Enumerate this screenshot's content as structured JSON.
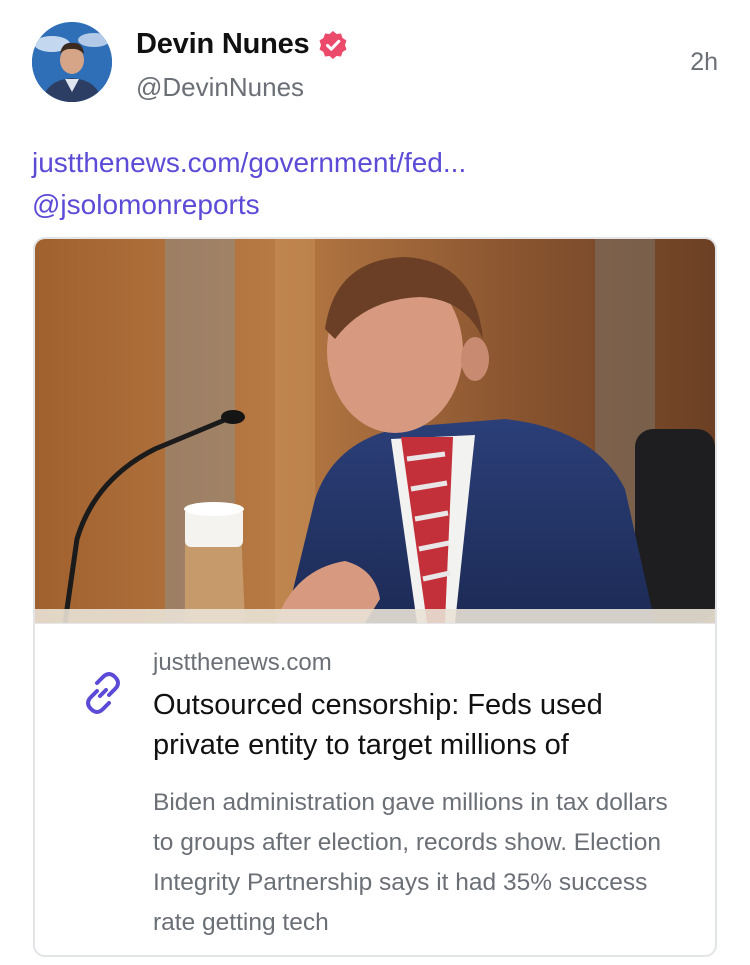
{
  "author": {
    "display_name": "Devin Nunes",
    "handle": "@DevinNunes",
    "verified": true,
    "avatar_icon": "avatar-photo"
  },
  "post": {
    "timestamp": "2h",
    "link_text": "justthenews.com/government/fed...",
    "mention_text": "@jsolomonreports"
  },
  "link_card": {
    "domain": "justthenews.com",
    "title": "Outsourced censorship: Feds used private entity to target millions of",
    "description": "Biden administration gave millions in tax dollars to groups after election, records show. Election Integrity Partnership says it had 35% success rate getting tech",
    "icon": "link-icon"
  },
  "colors": {
    "link": "#5b4bd6",
    "verified_badge": "#ec4a6b",
    "secondary_text": "#6b6f76",
    "border": "#e2e4e8"
  }
}
